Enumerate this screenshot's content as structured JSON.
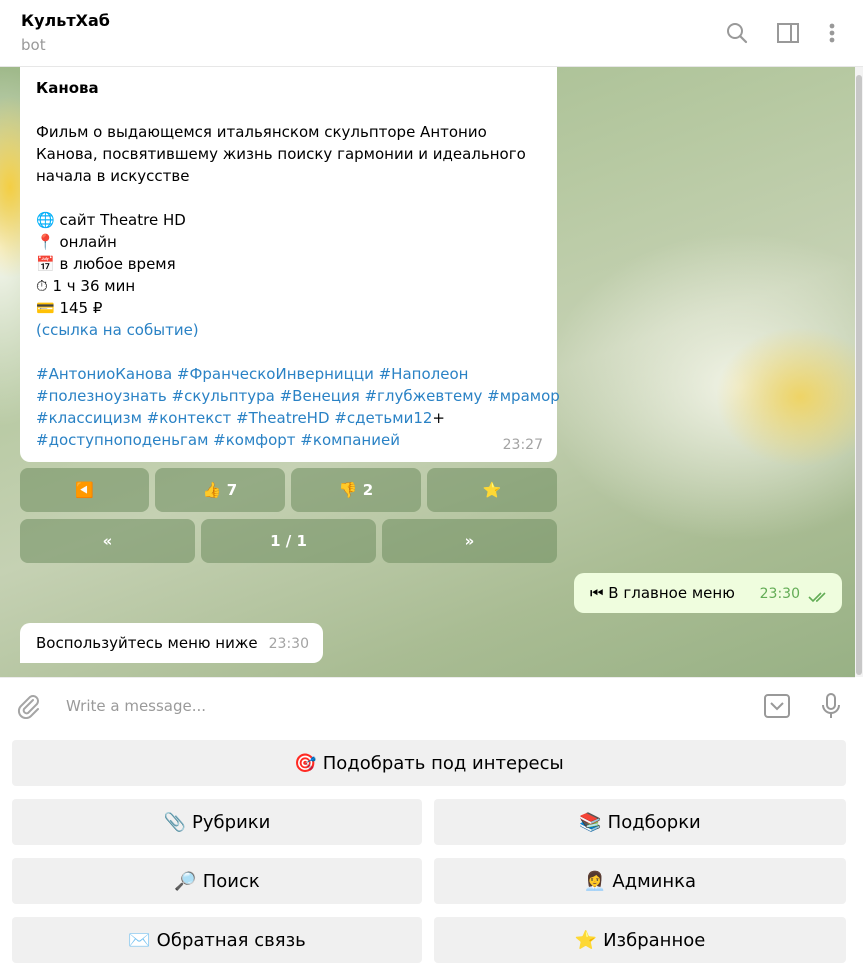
{
  "header": {
    "title": "КультХаб",
    "subtitle": "bot"
  },
  "message_event": {
    "title": "Канова",
    "description_lines": [
      "Фильм о выдающемся итальянском скульпторе Антонио",
      "Канова, посвятившему жизнь поиску гармонии и идеального",
      "начала в искусстве"
    ],
    "details": [
      {
        "icon": "🌐",
        "text": "сайт Theatre HD"
      },
      {
        "icon": "📍",
        "text": "онлайн"
      },
      {
        "icon": "📅",
        "text": "в любое время"
      },
      {
        "icon": "⏱",
        "text": "1 ч 36 мин"
      },
      {
        "icon": "💳",
        "text": "145 ₽"
      }
    ],
    "link": "(ссылка на событие)",
    "hashtag_lines": [
      {
        "tags": "#АнтониоКанова #ФранческоИнверницци #Наполеон",
        "suffix": ""
      },
      {
        "tags": "#полезноузнать #скульптура #Венеция #глубжевтему #мрамор",
        "suffix": ""
      },
      {
        "tags": "#классицизм #контекст #TheatreHD #сдетьми12",
        "suffix": "+"
      },
      {
        "tags": "#доступноподеньгам #комфорт #компанией",
        "suffix": ""
      }
    ],
    "time": "23:27"
  },
  "inline_keyboard": {
    "row1": [
      {
        "emoji": "◀️",
        "label": ""
      },
      {
        "emoji": "👍",
        "label": "7"
      },
      {
        "emoji": "👎",
        "label": "2"
      },
      {
        "emoji": "⭐",
        "label": ""
      }
    ],
    "row2": [
      {
        "label": "«"
      },
      {
        "label": "1 / 1"
      },
      {
        "label": "»"
      }
    ]
  },
  "message_out": {
    "emoji": "⏮",
    "text": "В главное меню",
    "time": "23:30"
  },
  "message_in": {
    "text": "Воспользуйтесь меню ниже",
    "time": "23:30"
  },
  "composer": {
    "placeholder": "Write a message..."
  },
  "reply_keyboard": {
    "match": {
      "emoji": "🎯",
      "label": "Подобрать под интересы"
    },
    "rubrics": {
      "emoji": "📎",
      "label": "Рубрики"
    },
    "collections": {
      "emoji": "📚",
      "label": "Подборки"
    },
    "search": {
      "emoji": "🔎",
      "label": "Поиск"
    },
    "admin": {
      "emoji": "👩‍💼",
      "label": "Админка"
    },
    "feedback": {
      "emoji": "✉️",
      "label": "Обратная связь"
    },
    "favorites": {
      "emoji": "⭐",
      "label": "Избранное"
    }
  },
  "colors": {
    "link": "#2a82c5",
    "outgoing_bubble": "#effdde",
    "outgoing_time": "#62ac55",
    "keyboard_button": "#f0f0f0"
  }
}
